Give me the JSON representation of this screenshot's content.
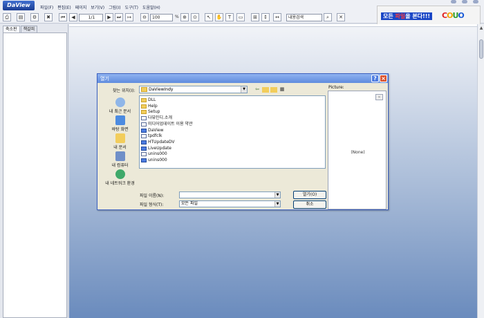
{
  "app": {
    "logo": "DaView",
    "title": "DaView"
  },
  "menu": [
    "파일(F)",
    "편집(E)",
    "페이지",
    "보기(V)",
    "그림(I)",
    "도구(T)",
    "도움말(H)"
  ],
  "toolbar": {
    "page_input": "1/1",
    "zoom_input": "100",
    "zoom_unit": "%",
    "search_input": "내용검색"
  },
  "ad": {
    "text_prefix": "모든 ",
    "text_highlight": "파일",
    "text_suffix": "을 본다!!!",
    "logo": [
      "C",
      "O",
      "U",
      "O"
    ]
  },
  "left_panel": {
    "tabs": [
      "축소판",
      "책갈피"
    ]
  },
  "dialog": {
    "title": "열기",
    "look_in_label": "찾는 위치(I):",
    "look_in_value": "DaViewIndy",
    "places": [
      "내 최근 문서",
      "바탕 화면",
      "내 문서",
      "내 컴퓨터",
      "내 네트워크 환경"
    ],
    "files": [
      {
        "name": "DLL",
        "type": "folder"
      },
      {
        "name": "Help",
        "type": "folder"
      },
      {
        "name": "Setup",
        "type": "folder"
      },
      {
        "name": "다뷰인디.소개",
        "type": "file"
      },
      {
        "name": "미디어업데이트 이용 약관",
        "type": "file"
      },
      {
        "name": "DaView",
        "type": "app"
      },
      {
        "name": "tpdfclk",
        "type": "file"
      },
      {
        "name": "HTUpdateDV",
        "type": "app"
      },
      {
        "name": "LiveUpdate",
        "type": "app"
      },
      {
        "name": "unins000",
        "type": "file"
      },
      {
        "name": "unins000",
        "type": "app"
      }
    ],
    "filename_label": "파일 이름(N):",
    "filename_value": "",
    "filetype_label": "파일 형식(T):",
    "filetype_value": "모든 파일",
    "open_button": "열기(O)",
    "cancel_button": "취소",
    "preview_label": "Picture:",
    "preview_none": "(None)"
  }
}
